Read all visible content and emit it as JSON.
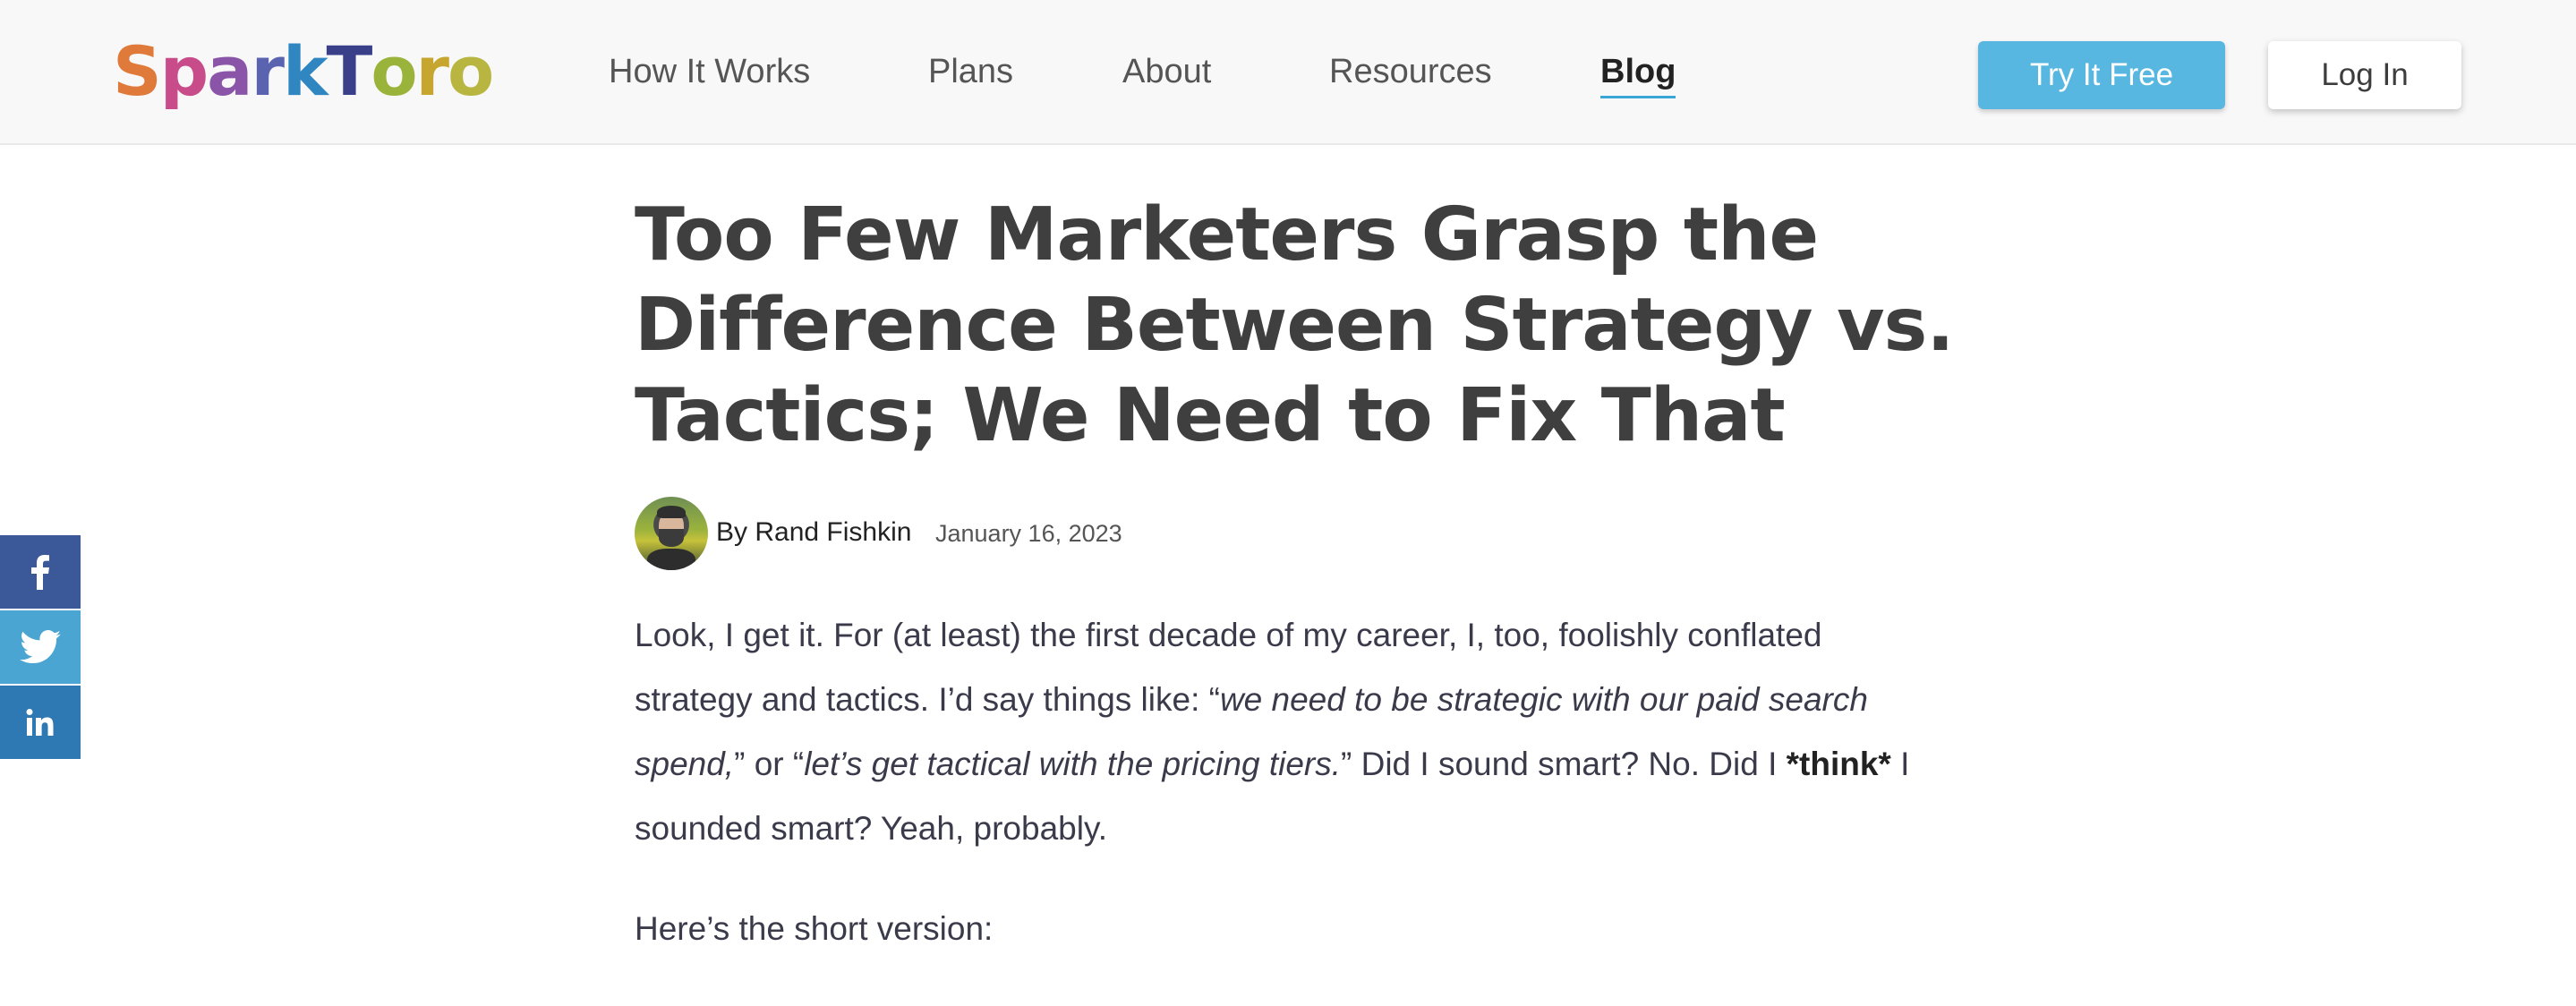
{
  "header": {
    "logo_letters": [
      {
        "ch": "S",
        "color": "#e07a3a"
      },
      {
        "ch": "p",
        "color": "#c84b8a"
      },
      {
        "ch": "a",
        "color": "#8a55a8"
      },
      {
        "ch": "r",
        "color": "#5a63b0"
      },
      {
        "ch": "k",
        "color": "#2f86c1"
      },
      {
        "ch": "T",
        "color": "#3a3f8a"
      },
      {
        "ch": "o",
        "color": "#9ab33a"
      },
      {
        "ch": "r",
        "color": "#c7a630"
      },
      {
        "ch": "o",
        "color": "#b8b640"
      }
    ],
    "nav": {
      "how_it_works": "How It Works",
      "plans": "Plans",
      "about": "About",
      "resources": "Resources",
      "blog": "Blog"
    },
    "try_label": "Try It Free",
    "login_label": "Log In"
  },
  "share": {
    "facebook_icon": "facebook-icon",
    "twitter_icon": "twitter-icon",
    "linkedin_icon": "linkedin-icon"
  },
  "article": {
    "title_lines": [
      "Too Few Marketers Grasp the",
      "Difference Between Strategy vs.",
      "Tactics; We Need to Fix That"
    ],
    "by_prefix": "By ",
    "author": "Rand Fishkin",
    "date": "January 16, 2023",
    "p1_lines": {
      "l1": "Look, I get it. For (at least) the first decade of my career, I, too, foolishly conflated",
      "l2_a": "strategy and tactics. I’d say things like: “",
      "l2_em": "we need to be strategic with our paid search",
      "l3_em1": "spend,",
      "l3_b": "” or “",
      "l3_em2": "let’s get tactical with the pricing tiers.",
      "l3_c": "” Did I sound smart? No. Did I ",
      "l3_strong": "*think*",
      "l3_d": " I",
      "l4": "sounded smart? Yeah, probably."
    },
    "p2": "Here’s the short version:"
  }
}
